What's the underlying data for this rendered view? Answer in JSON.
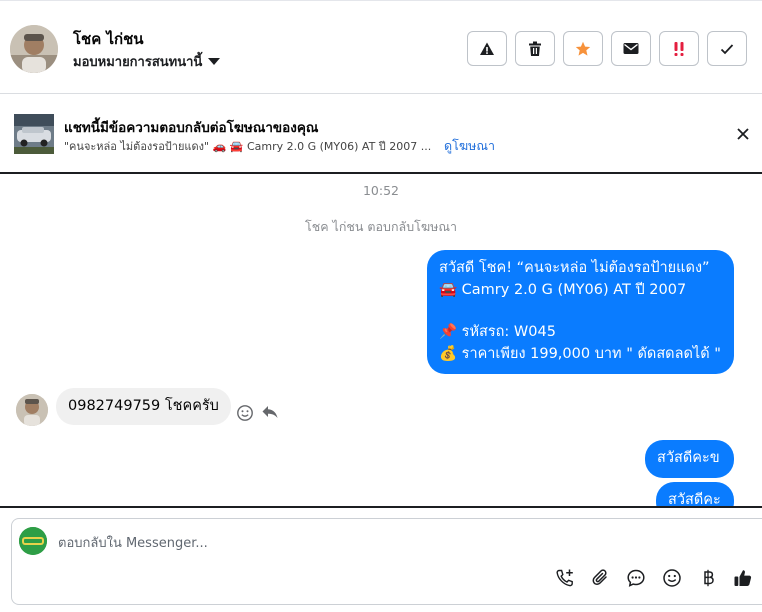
{
  "header": {
    "contact_name": "โชค ไก่ชน",
    "assign_label": "มอบหมายการสนทนานี้",
    "actions": [
      "spam-warning",
      "delete",
      "star",
      "mark-unread",
      "important",
      "done"
    ]
  },
  "ad": {
    "title": "แชทนี้มีข้อความตอบกลับต่อโฆษณาของคุณ",
    "subtitle": "\"คนจะหล่อ ไม่ต้องรอป้ายแดง\" 🚗 🚘 Camry 2.0 G (MY06) AT ปี 2007 ...",
    "link": "ดูโฆษณา"
  },
  "thread": {
    "time": "10:52",
    "system_message": "โชค ไก่ชน ตอบกลับโฆษณา",
    "outgoing_1": {
      "line1": "สวัสดี โชค! “คนจะหล่อ ไม่ต้องรอป้ายแดง”",
      "line2": "🚘 Camry 2.0 G (MY06) AT ปี 2007",
      "line3": "📌 รหัสรถ: W045",
      "line4": "💰 ราคาเพียง 199,000 บาท \" ดัดสดลดได้ \""
    },
    "incoming_1": "0982749759 โชคครับ",
    "outgoing_2": "สวัสดีคะข",
    "outgoing_3": "สวัสดีคะ"
  },
  "composer": {
    "placeholder": "ตอบกลับใน Messenger...",
    "tools": [
      "call-add-icon",
      "attach-icon",
      "saved-reply-icon",
      "emoji-icon",
      "baht-icon",
      "thumbs-up-icon"
    ]
  },
  "colors": {
    "outgoing_bubble": "#0a7cff",
    "incoming_bubble": "#f0f0f0",
    "link": "#216fdb",
    "star": "#f7923b",
    "important": "#e41e3f"
  }
}
